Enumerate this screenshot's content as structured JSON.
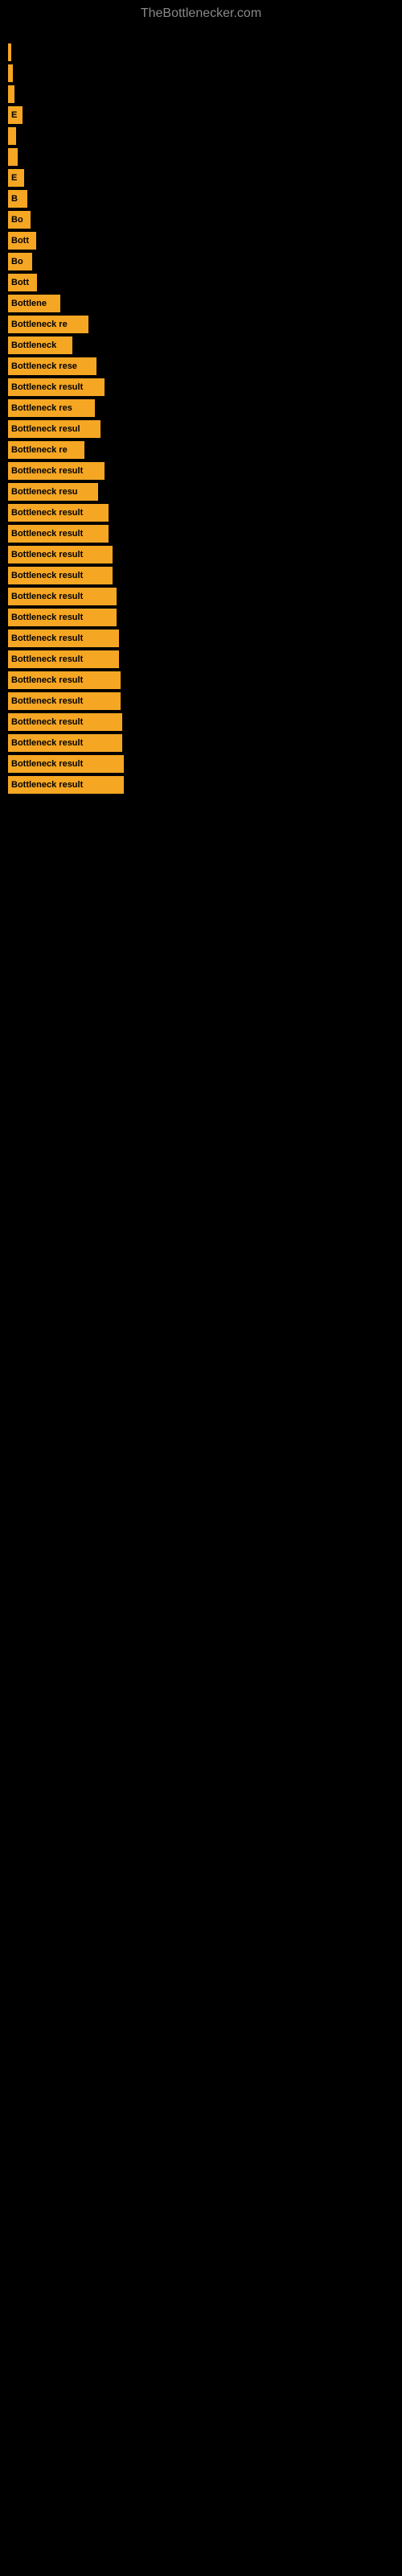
{
  "site": {
    "title": "TheBottlenecker.com"
  },
  "bars": [
    {
      "width": 4,
      "label": ""
    },
    {
      "width": 6,
      "label": ""
    },
    {
      "width": 8,
      "label": ""
    },
    {
      "width": 18,
      "label": "E"
    },
    {
      "width": 10,
      "label": ""
    },
    {
      "width": 12,
      "label": ""
    },
    {
      "width": 20,
      "label": "E"
    },
    {
      "width": 24,
      "label": "B"
    },
    {
      "width": 28,
      "label": "Bo"
    },
    {
      "width": 35,
      "label": "Bott"
    },
    {
      "width": 30,
      "label": "Bo"
    },
    {
      "width": 36,
      "label": "Bott"
    },
    {
      "width": 65,
      "label": "Bottlene"
    },
    {
      "width": 100,
      "label": "Bottleneck re"
    },
    {
      "width": 80,
      "label": "Bottleneck"
    },
    {
      "width": 110,
      "label": "Bottleneck rese"
    },
    {
      "width": 120,
      "label": "Bottleneck result"
    },
    {
      "width": 108,
      "label": "Bottleneck res"
    },
    {
      "width": 115,
      "label": "Bottleneck resul"
    },
    {
      "width": 95,
      "label": "Bottleneck re"
    },
    {
      "width": 120,
      "label": "Bottleneck result"
    },
    {
      "width": 112,
      "label": "Bottleneck resu"
    },
    {
      "width": 125,
      "label": "Bottleneck result"
    },
    {
      "width": 125,
      "label": "Bottleneck result"
    },
    {
      "width": 130,
      "label": "Bottleneck result"
    },
    {
      "width": 130,
      "label": "Bottleneck result"
    },
    {
      "width": 135,
      "label": "Bottleneck result"
    },
    {
      "width": 135,
      "label": "Bottleneck result"
    },
    {
      "width": 138,
      "label": "Bottleneck result"
    },
    {
      "width": 138,
      "label": "Bottleneck result"
    },
    {
      "width": 140,
      "label": "Bottleneck result"
    },
    {
      "width": 140,
      "label": "Bottleneck result"
    },
    {
      "width": 142,
      "label": "Bottleneck result"
    },
    {
      "width": 142,
      "label": "Bottleneck result"
    },
    {
      "width": 144,
      "label": "Bottleneck result"
    },
    {
      "width": 144,
      "label": "Bottleneck result"
    }
  ]
}
